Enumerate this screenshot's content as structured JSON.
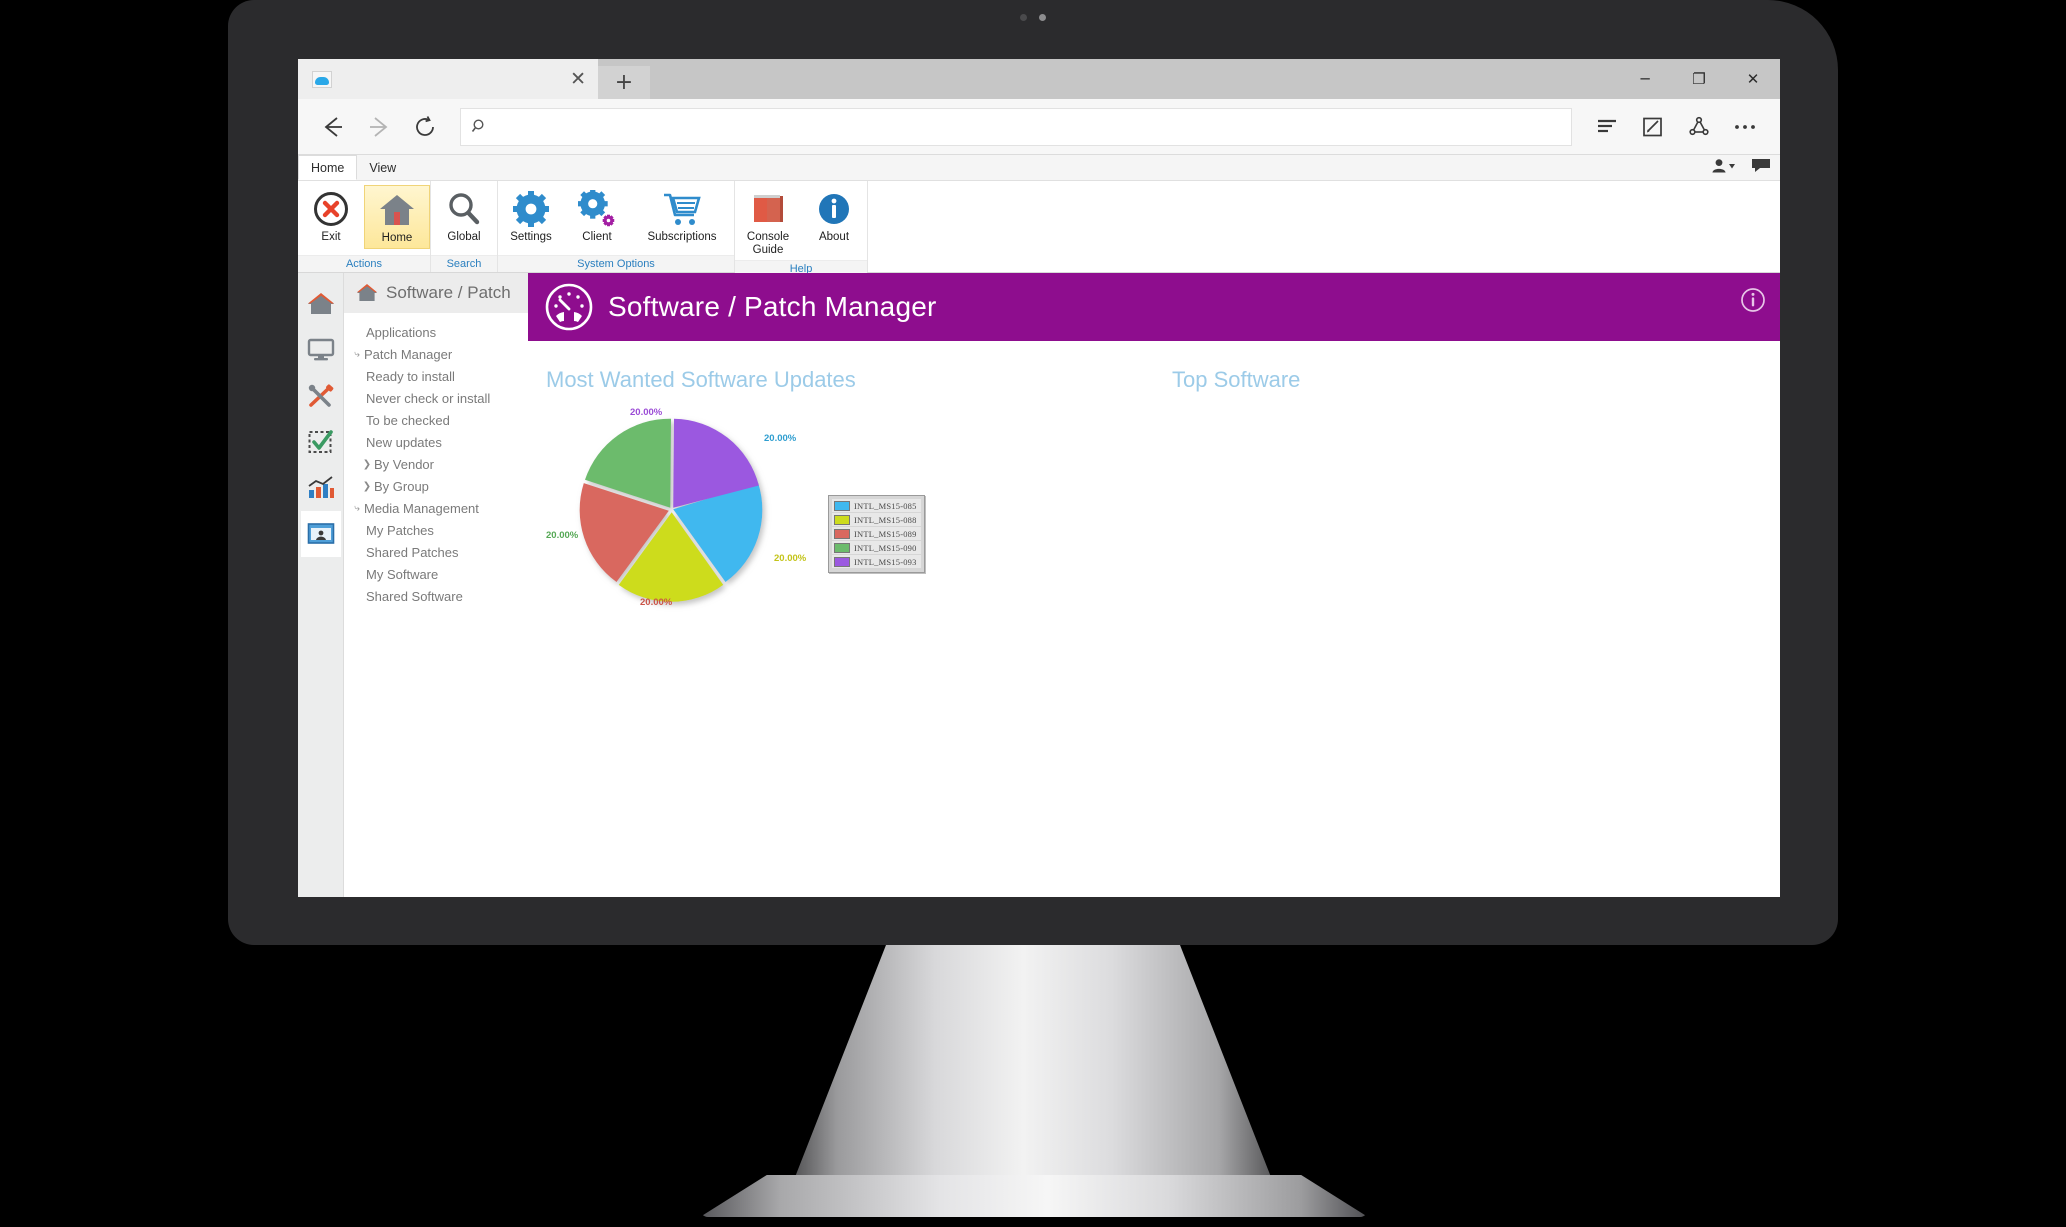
{
  "browser": {
    "tab": {
      "title": "",
      "favicon": "cloud-icon",
      "close_label": "✕"
    },
    "new_tab_label": "+",
    "window_controls": {
      "minimize": "─",
      "maximize": "❐",
      "close": "✕"
    },
    "nav": {
      "back": "back-arrow-icon",
      "forward": "forward-arrow-icon",
      "refresh": "refresh-icon"
    },
    "address": {
      "value": "",
      "placeholder": "",
      "search_icon": "search-icon"
    },
    "right_icons": [
      "reading-list-icon",
      "web-note-icon",
      "share-icon",
      "more-icon"
    ]
  },
  "ribbon": {
    "tabs": [
      {
        "label": "Home",
        "active": true
      },
      {
        "label": "View",
        "active": false
      }
    ],
    "right_icons": [
      "user-account-icon",
      "feedback-icon"
    ],
    "groups": [
      {
        "label": "Actions",
        "buttons": [
          {
            "label": "Exit",
            "icon": "exit-icon",
            "selected": false
          },
          {
            "label": "Home",
            "icon": "home-icon",
            "selected": true
          }
        ]
      },
      {
        "label": "Search",
        "buttons": [
          {
            "label": "Global",
            "icon": "magnifier-icon",
            "selected": false
          }
        ]
      },
      {
        "label": "System Options",
        "buttons": [
          {
            "label": "Settings",
            "icon": "gear-icon",
            "selected": false
          },
          {
            "label": "Client",
            "icon": "gears-icon",
            "selected": false
          },
          {
            "label": "Subscriptions",
            "icon": "cart-icon",
            "selected": false
          }
        ]
      },
      {
        "label": "Help",
        "buttons": [
          {
            "label": "Console Guide",
            "icon": "book-icon",
            "selected": false
          },
          {
            "label": "About",
            "icon": "info-icon",
            "selected": false
          }
        ]
      }
    ]
  },
  "rail": {
    "icons": [
      {
        "name": "home-icon",
        "selected": false
      },
      {
        "name": "monitor-icon",
        "selected": false
      },
      {
        "name": "tools-icon",
        "selected": false
      },
      {
        "name": "checklist-icon",
        "selected": false
      },
      {
        "name": "chart-icon",
        "selected": false
      },
      {
        "name": "presentation-icon",
        "selected": true
      }
    ]
  },
  "sidebar": {
    "header": "Software / Patch",
    "tree": [
      {
        "label": "Applications",
        "level": 1,
        "twisty": ""
      },
      {
        "label": "Patch Manager",
        "level": 0,
        "twisty": "⤷"
      },
      {
        "label": "Ready to install",
        "level": 1,
        "twisty": ""
      },
      {
        "label": "Never check or install",
        "level": 1,
        "twisty": ""
      },
      {
        "label": "To be checked",
        "level": 1,
        "twisty": ""
      },
      {
        "label": "New updates",
        "level": 1,
        "twisty": ""
      },
      {
        "label": "By Vendor",
        "level": 0,
        "twisty": "❯",
        "indent": true
      },
      {
        "label": "By Group",
        "level": 0,
        "twisty": "❯",
        "indent": true
      },
      {
        "label": "Media Management",
        "level": 0,
        "twisty": "⤷"
      },
      {
        "label": "My Patches",
        "level": 1,
        "twisty": ""
      },
      {
        "label": "Shared Patches",
        "level": 1,
        "twisty": ""
      },
      {
        "label": "My Software",
        "level": 1,
        "twisty": ""
      },
      {
        "label": "Shared Software",
        "level": 1,
        "twisty": ""
      }
    ]
  },
  "content": {
    "banner": {
      "title": "Software / Patch Manager",
      "icon": "gauge-icon",
      "info_icon": "info-circle-icon",
      "color": "#8e0d8e"
    },
    "panels": [
      {
        "title": "Most Wanted Software Updates"
      },
      {
        "title": "Top Software"
      }
    ]
  },
  "chart_data": {
    "type": "pie",
    "title": "Most Wanted Software Updates",
    "labels": [
      "INTL_MS15-085",
      "INTL_MS15-088",
      "INTL_MS15-089",
      "INTL_MS15-090",
      "INTL_MS15-093"
    ],
    "values": [
      20.0,
      20.0,
      20.0,
      20.0,
      20.0
    ],
    "value_labels": [
      "20.00%",
      "20.00%",
      "20.00%",
      "20.00%",
      "20.00%"
    ],
    "colors": [
      "#3fb8ef",
      "#cddc1e",
      "#d9685f",
      "#6cbb6c",
      "#9b59e0"
    ],
    "legend_position": "right",
    "exploded": true
  }
}
